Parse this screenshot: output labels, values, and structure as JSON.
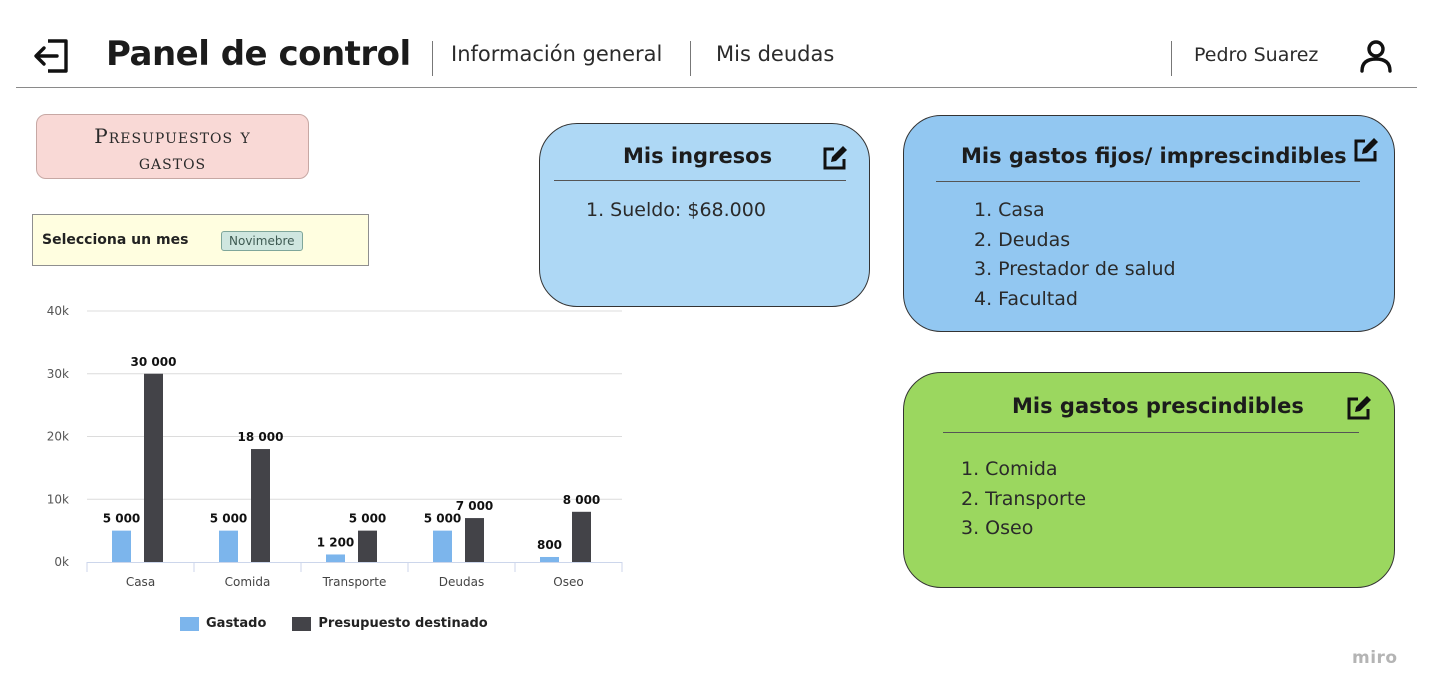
{
  "header": {
    "title": "Panel de control",
    "nav": [
      {
        "label": "Información general"
      },
      {
        "label": "Mis deudas"
      }
    ],
    "user_name": "Pedro Suarez",
    "logout_icon": "logout-icon",
    "user_icon": "user-icon"
  },
  "section": {
    "label_line1": "Presupuestos y",
    "label_line2": "gastos"
  },
  "month_selector": {
    "label": "Selecciona un mes",
    "selected": "Novimebre"
  },
  "chart_data": {
    "type": "bar",
    "categories": [
      "Casa",
      "Comida",
      "Transporte",
      "Deudas",
      "Oseo"
    ],
    "series": [
      {
        "name": "Gastado",
        "values": [
          5000,
          5000,
          1200,
          5000,
          800
        ],
        "labels": [
          "5 000",
          "5 000",
          "1 200",
          "5 000",
          "800"
        ],
        "color": "#7cb5ec"
      },
      {
        "name": "Presupuesto destinado",
        "values": [
          30000,
          18000,
          5000,
          7000,
          8000
        ],
        "labels": [
          "30 000",
          "18 000",
          "5 000",
          "7 000",
          "8 000"
        ],
        "color": "#434348"
      }
    ],
    "y_ticks": [
      "0k",
      "10k",
      "20k",
      "30k",
      "40k"
    ],
    "ylim": [
      0,
      40000
    ],
    "grid": true,
    "legend_position": "bottom"
  },
  "cards": {
    "ingresos": {
      "title": "Mis ingresos",
      "items": [
        "1. Sueldo:  $68.000"
      ],
      "color": "#aed8f5"
    },
    "fijos": {
      "title": "Mis gastos fijos/ imprescindibles",
      "items": [
        "1. Casa",
        "2. Deudas",
        "3. Prestador de salud",
        "4. Facultad"
      ],
      "color": "#92c7f1"
    },
    "prescindibles": {
      "title": "Mis gastos prescindibles",
      "items": [
        "1. Comida",
        "2. Transporte",
        "3. Oseo"
      ],
      "color": "#9bd75f"
    }
  },
  "footer": {
    "brand": "miro"
  }
}
